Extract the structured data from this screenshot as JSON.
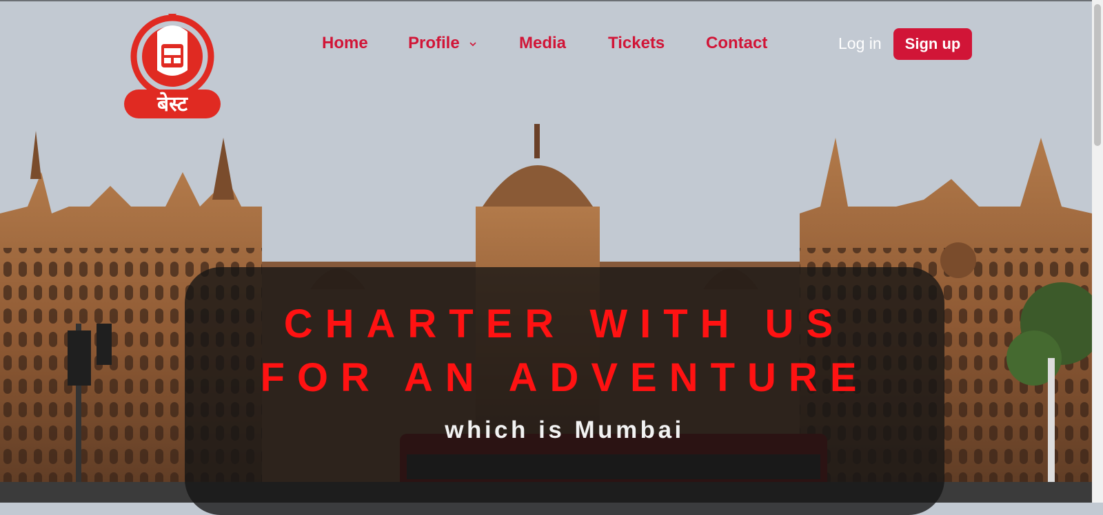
{
  "brand": {
    "logo_text": "बेस्ट",
    "accent": "#d11537"
  },
  "nav": {
    "items": [
      {
        "label": "Home"
      },
      {
        "label": "Profile",
        "has_dropdown": true
      },
      {
        "label": "Media"
      },
      {
        "label": "Tickets"
      },
      {
        "label": "Contact"
      }
    ],
    "login_label": "Log in",
    "signup_label": "Sign up"
  },
  "hero": {
    "headline_line1": "CHARTER WITH US",
    "headline_line2": "FOR AN ADVENTURE",
    "subheadline": "which is Mumbai",
    "headline_color": "#ff1212"
  }
}
